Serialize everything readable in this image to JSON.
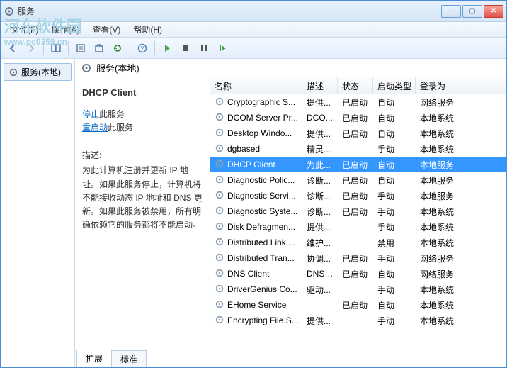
{
  "window": {
    "title": "服务",
    "watermark_main": "河东软件园",
    "watermark_sub": "www.pc0359.cn"
  },
  "menu": {
    "file": "文件(F)",
    "action": "操作(A)",
    "view": "查看(V)",
    "help": "帮助(H)"
  },
  "left": {
    "node": "服务(本地)"
  },
  "header": {
    "title": "服务(本地)"
  },
  "detail": {
    "name": "DHCP Client",
    "stop_link": "停止",
    "stop_suffix": "此服务",
    "restart_link": "重启动",
    "restart_suffix": "此服务",
    "desc_label": "描述:",
    "desc": "为此计算机注册并更新 IP 地址。如果此服务停止，计算机将不能接收动态 IP 地址和 DNS 更新。如果此服务被禁用，所有明确依赖它的服务都将不能启动。"
  },
  "columns": {
    "name": "名称",
    "desc": "描述",
    "status": "状态",
    "start": "启动类型",
    "logon": "登录为"
  },
  "rows": [
    {
      "name": "Cryptographic S...",
      "desc": "提供...",
      "status": "已启动",
      "start": "自动",
      "logon": "网络服务",
      "sel": false
    },
    {
      "name": "DCOM Server Pr...",
      "desc": "DCO...",
      "status": "已启动",
      "start": "自动",
      "logon": "本地系统",
      "sel": false
    },
    {
      "name": "Desktop Windo...",
      "desc": "提供...",
      "status": "已启动",
      "start": "自动",
      "logon": "本地系统",
      "sel": false
    },
    {
      "name": "dgbased",
      "desc": "精灵...",
      "status": "",
      "start": "手动",
      "logon": "本地系统",
      "sel": false
    },
    {
      "name": "DHCP Client",
      "desc": "为此...",
      "status": "已启动",
      "start": "自动",
      "logon": "本地服务",
      "sel": true
    },
    {
      "name": "Diagnostic Polic...",
      "desc": "诊断...",
      "status": "已启动",
      "start": "自动",
      "logon": "本地服务",
      "sel": false
    },
    {
      "name": "Diagnostic Servi...",
      "desc": "诊断...",
      "status": "已启动",
      "start": "手动",
      "logon": "本地服务",
      "sel": false
    },
    {
      "name": "Diagnostic Syste...",
      "desc": "诊断...",
      "status": "已启动",
      "start": "手动",
      "logon": "本地系统",
      "sel": false
    },
    {
      "name": "Disk Defragmen...",
      "desc": "提供...",
      "status": "",
      "start": "手动",
      "logon": "本地系统",
      "sel": false
    },
    {
      "name": "Distributed Link ...",
      "desc": "维护...",
      "status": "",
      "start": "禁用",
      "logon": "本地系统",
      "sel": false
    },
    {
      "name": "Distributed Tran...",
      "desc": "协调...",
      "status": "已启动",
      "start": "手动",
      "logon": "网络服务",
      "sel": false
    },
    {
      "name": "DNS Client",
      "desc": "DNS ...",
      "status": "已启动",
      "start": "自动",
      "logon": "网络服务",
      "sel": false
    },
    {
      "name": "DriverGenius Co...",
      "desc": "驱动...",
      "status": "",
      "start": "手动",
      "logon": "本地系统",
      "sel": false
    },
    {
      "name": "EHome Service",
      "desc": "",
      "status": "已启动",
      "start": "自动",
      "logon": "本地系统",
      "sel": false
    },
    {
      "name": "Encrypting File S...",
      "desc": "提供...",
      "status": "",
      "start": "手动",
      "logon": "本地系统",
      "sel": false
    }
  ],
  "tabs": {
    "extended": "扩展",
    "standard": "标准"
  }
}
